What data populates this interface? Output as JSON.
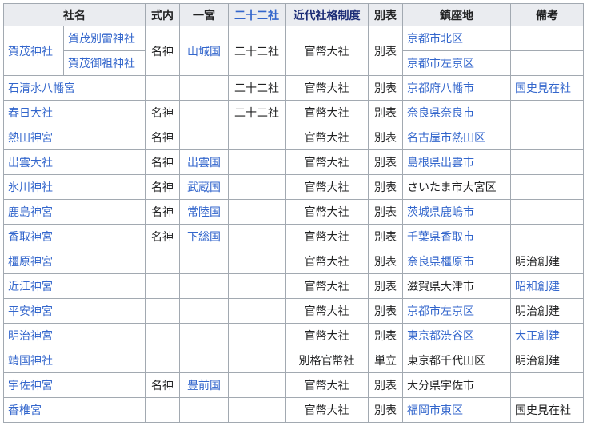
{
  "headers": [
    "社名",
    "式内",
    "一宮",
    "二十二社",
    "近代社格制度",
    "別表",
    "鎮座地",
    "備考"
  ],
  "kamo": {
    "name": "賀茂神社",
    "sub": [
      "賀茂別雷神社",
      "賀茂御祖神社"
    ],
    "shikinai": "名神",
    "ichinomiya": "山城国",
    "nijunisha": "二十二社",
    "kakaku": "官幣大社",
    "beppyo": "別表",
    "locations": [
      "京都市北区",
      "京都市左京区"
    ]
  },
  "rows": [
    {
      "name": "石清水八幡宮",
      "shikinai": "",
      "ichinomiya": "",
      "nijunisha": "二十二社",
      "kakaku": "官幣大社",
      "beppyo": "別表",
      "location": "京都府八幡市",
      "note": "国史見在社"
    },
    {
      "name": "春日大社",
      "shikinai": "名神",
      "ichinomiya": "",
      "nijunisha": "二十二社",
      "kakaku": "官幣大社",
      "beppyo": "別表",
      "location": "奈良県奈良市",
      "note": ""
    },
    {
      "name": "熱田神宮",
      "shikinai": "名神",
      "ichinomiya": "",
      "nijunisha": "",
      "kakaku": "官幣大社",
      "beppyo": "別表",
      "location": "名古屋市熱田区",
      "note": ""
    },
    {
      "name": "出雲大社",
      "shikinai": "名神",
      "ichinomiya": "出雲国",
      "nijunisha": "",
      "kakaku": "官幣大社",
      "beppyo": "別表",
      "location": "島根県出雲市",
      "note": ""
    },
    {
      "name": "氷川神社",
      "shikinai": "名神",
      "ichinomiya": "武蔵国",
      "nijunisha": "",
      "kakaku": "官幣大社",
      "beppyo": "別表",
      "location": "さいたま市大宮区",
      "note": ""
    },
    {
      "name": "鹿島神宮",
      "shikinai": "名神",
      "ichinomiya": "常陸国",
      "nijunisha": "",
      "kakaku": "官幣大社",
      "beppyo": "別表",
      "location": "茨城県鹿嶋市",
      "note": ""
    },
    {
      "name": "香取神宮",
      "shikinai": "名神",
      "ichinomiya": "下総国",
      "nijunisha": "",
      "kakaku": "官幣大社",
      "beppyo": "別表",
      "location": "千葉県香取市",
      "note": ""
    },
    {
      "name": "橿原神宮",
      "shikinai": "",
      "ichinomiya": "",
      "nijunisha": "",
      "kakaku": "官幣大社",
      "beppyo": "別表",
      "location": "奈良県橿原市",
      "note": "明治創建"
    },
    {
      "name": "近江神宮",
      "shikinai": "",
      "ichinomiya": "",
      "nijunisha": "",
      "kakaku": "官幣大社",
      "beppyo": "別表",
      "location": "滋賀県大津市",
      "note": "昭和創建"
    },
    {
      "name": "平安神宮",
      "shikinai": "",
      "ichinomiya": "",
      "nijunisha": "",
      "kakaku": "官幣大社",
      "beppyo": "別表",
      "location": "京都市左京区",
      "note": "明治創建"
    },
    {
      "name": "明治神宮",
      "shikinai": "",
      "ichinomiya": "",
      "nijunisha": "",
      "kakaku": "官幣大社",
      "beppyo": "別表",
      "location": "東京都渋谷区",
      "note": "大正創建"
    },
    {
      "name": "靖国神社",
      "shikinai": "",
      "ichinomiya": "",
      "nijunisha": "",
      "kakaku": "別格官幣社",
      "beppyo": "単立",
      "location": "東京都千代田区",
      "note": "明治創建"
    },
    {
      "name": "宇佐神宮",
      "shikinai": "名神",
      "ichinomiya": "豊前国",
      "nijunisha": "",
      "kakaku": "官幣大社",
      "beppyo": "別表",
      "location": "大分県宇佐市",
      "note": ""
    },
    {
      "name": "香椎宮",
      "shikinai": "",
      "ichinomiya": "",
      "nijunisha": "",
      "kakaku": "官幣大社",
      "beppyo": "別表",
      "location": "福岡市東区",
      "note": "国史見在社"
    }
  ],
  "colors": {
    "link": "#3366cc",
    "text": "#202122",
    "header_bg": "#eaecf0",
    "border": "#a2a9b1",
    "header_link_dark": "#1a2b75"
  }
}
